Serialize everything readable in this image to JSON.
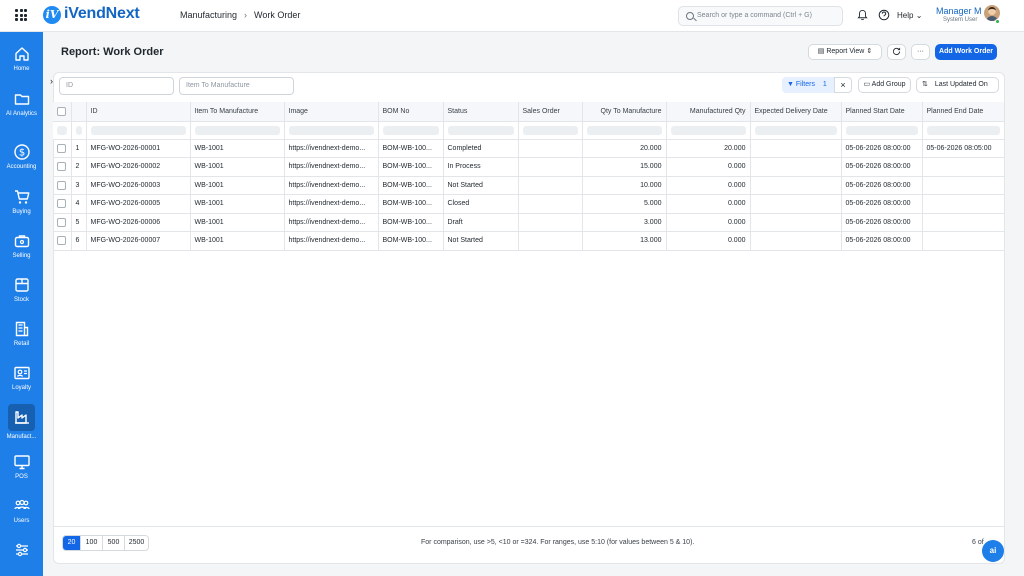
{
  "app": {
    "name": "iVendNext",
    "logo_letter": "iV"
  },
  "breadcrumb": {
    "parent": "Manufacturing",
    "current": "Work Order"
  },
  "search": {
    "placeholder": "Search or type a command (Ctrl + G)"
  },
  "header": {
    "help_label": "Help",
    "user_name": "Manager M",
    "user_role": "System User"
  },
  "sidebar": {
    "items": [
      {
        "label": "Home",
        "icon": "home-icon"
      },
      {
        "label": "AI Analytics",
        "icon": "folder-icon"
      },
      {
        "label": "Accounting",
        "icon": "dollar-icon"
      },
      {
        "label": "Buying",
        "icon": "cart-icon"
      },
      {
        "label": "Selling",
        "icon": "briefcase-icon"
      },
      {
        "label": "Stock",
        "icon": "box-icon"
      },
      {
        "label": "Retail",
        "icon": "store-icon"
      },
      {
        "label": "Loyalty",
        "icon": "id-card-icon"
      },
      {
        "label": "Manufact...",
        "icon": "factory-icon"
      },
      {
        "label": "POS",
        "icon": "monitor-icon"
      },
      {
        "label": "Users",
        "icon": "users-icon"
      },
      {
        "label": "",
        "icon": "sliders-icon"
      }
    ]
  },
  "page": {
    "title": "Report: Work Order",
    "report_view_label": "Report View",
    "more_label": "···",
    "add_button_label": "Add Work Order"
  },
  "filters": {
    "id_placeholder": "ID",
    "item_placeholder": "Item To Manufacture",
    "filters_label": "Filters",
    "filters_count": "1",
    "add_group_label": "Add Group",
    "sort_label": "Last Updated On"
  },
  "table": {
    "columns": [
      "ID",
      "Item To Manufacture",
      "Image",
      "BOM No",
      "Status",
      "Sales Order",
      "Qty To Manufacture",
      "Manufactured Qty",
      "Expected Delivery Date",
      "Planned Start Date",
      "Planned End Date"
    ],
    "rows": [
      {
        "n": "1",
        "id": "MFG-WO-2026-00001",
        "item": "WB-1001",
        "image": "https://ivendnext-demo...",
        "bom": "BOM-WB-100...",
        "status": "Completed",
        "so": "",
        "qty": "20.000",
        "mqty": "20.000",
        "edd": "",
        "psd": "05-06-2026 08:00:00",
        "ped": "05-06-2026 08:05:00"
      },
      {
        "n": "2",
        "id": "MFG-WO-2026-00002",
        "item": "WB-1001",
        "image": "https://ivendnext-demo...",
        "bom": "BOM-WB-100...",
        "status": "In Process",
        "so": "",
        "qty": "15.000",
        "mqty": "0.000",
        "edd": "",
        "psd": "05-06-2026 08:00:00",
        "ped": ""
      },
      {
        "n": "3",
        "id": "MFG-WO-2026-00003",
        "item": "WB-1001",
        "image": "https://ivendnext-demo...",
        "bom": "BOM-WB-100...",
        "status": "Not Started",
        "so": "",
        "qty": "10.000",
        "mqty": "0.000",
        "edd": "",
        "psd": "05-06-2026 08:00:00",
        "ped": ""
      },
      {
        "n": "4",
        "id": "MFG-WO-2026-00005",
        "item": "WB-1001",
        "image": "https://ivendnext-demo...",
        "bom": "BOM-WB-100...",
        "status": "Closed",
        "so": "",
        "qty": "5.000",
        "mqty": "0.000",
        "edd": "",
        "psd": "05-06-2026 08:00:00",
        "ped": ""
      },
      {
        "n": "5",
        "id": "MFG-WO-2026-00006",
        "item": "WB-1001",
        "image": "https://ivendnext-demo...",
        "bom": "BOM-WB-100...",
        "status": "Draft",
        "so": "",
        "qty": "3.000",
        "mqty": "0.000",
        "edd": "",
        "psd": "05-06-2026 08:00:00",
        "ped": ""
      },
      {
        "n": "6",
        "id": "MFG-WO-2026-00007",
        "item": "WB-1001",
        "image": "https://ivendnext-demo...",
        "bom": "BOM-WB-100...",
        "status": "Not Started",
        "so": "",
        "qty": "13.000",
        "mqty": "0.000",
        "edd": "",
        "psd": "05-06-2026 08:00:00",
        "ped": ""
      }
    ]
  },
  "footer": {
    "page_sizes": [
      "20",
      "100",
      "500",
      "2500"
    ],
    "selected_page_size": "20",
    "hint": "For comparison, use >5, <10 or =324. For ranges, use 5:10 (for values between 5 & 10).",
    "count": "6 of",
    "ai_label": "ai"
  },
  "colors": {
    "brand": "#1f7fe8",
    "primary": "#1366e6"
  }
}
